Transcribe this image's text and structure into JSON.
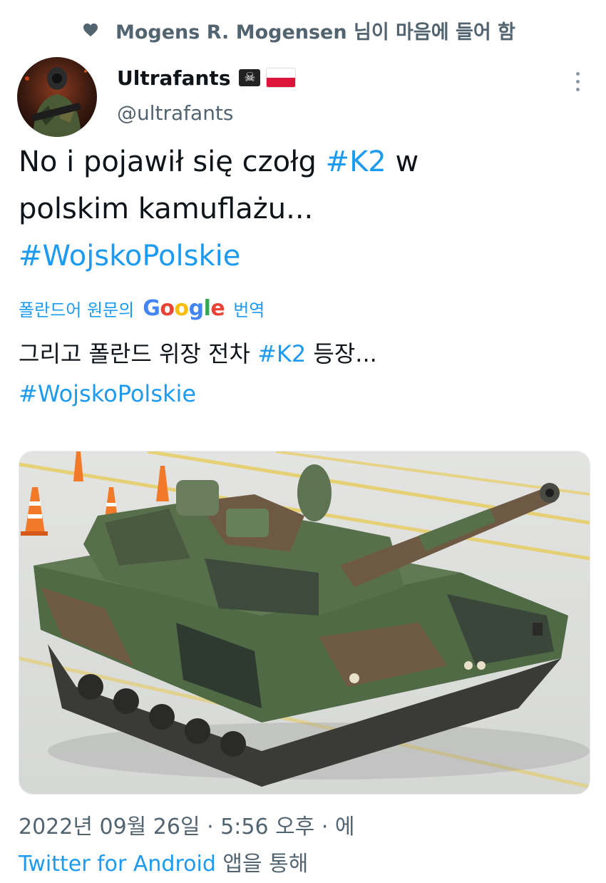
{
  "liked_by": {
    "text": "Mogens R. Mogensen 님이 마음에 들어 함",
    "icon": "heart-icon"
  },
  "author": {
    "display_name": "Ultrafants",
    "badge_skull": "☠",
    "handle": "@ultrafants"
  },
  "tweet": {
    "line1_prefix": "No i pojawił się czołg ",
    "hashtag_k2": "#K2",
    "line1_suffix": " w",
    "line2": "polskim kamuflażu...",
    "hashtag_wojsko": "#WojskoPolskie"
  },
  "translation": {
    "label_prefix": "폴란드어 원문의",
    "google_letters": [
      "G",
      "o",
      "o",
      "g",
      "l",
      "e"
    ],
    "label_suffix": "번역",
    "text_prefix": "그리고 폴란드 위장 전차 ",
    "hashtag_k2": "#K2",
    "text_suffix": " 등장...",
    "hashtag_wojsko": "#WojskoPolskie"
  },
  "meta": {
    "timestamp": "2022년 09월 26일 · 5:56 오후 · 에",
    "source": "Twitter for Android",
    "source_suffix": " 앱을 통해"
  },
  "colors": {
    "accent": "#1d9bf0",
    "muted": "#536471",
    "text": "#0f1419"
  }
}
